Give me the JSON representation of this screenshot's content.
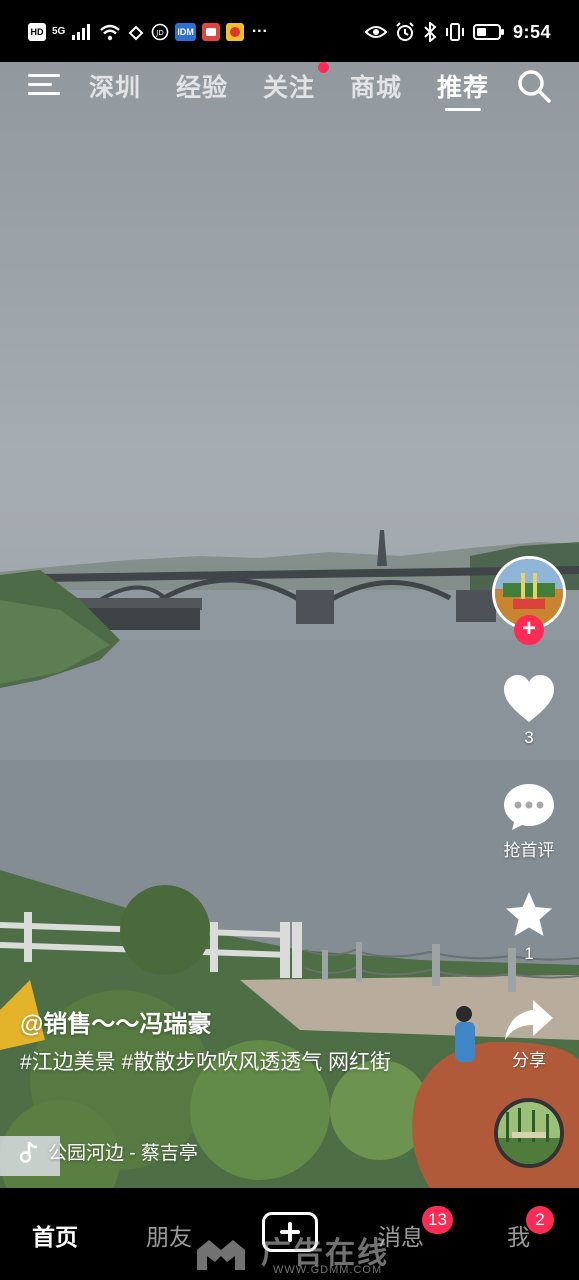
{
  "status_bar": {
    "left_chips": [
      "HD",
      "5G",
      "IDM"
    ],
    "time": "9:54"
  },
  "top_nav": {
    "tabs": [
      {
        "label": "深圳",
        "active": false
      },
      {
        "label": "经验",
        "active": false
      },
      {
        "label": "关注",
        "active": false
      },
      {
        "label": "商城",
        "active": false
      },
      {
        "label": "推荐",
        "active": true
      }
    ]
  },
  "actions": {
    "like_count": "3",
    "comment_label": "抢首评",
    "favorite_count": "1",
    "share_label": "分享"
  },
  "caption": {
    "author": "@销售～～冯瑞豪",
    "description": "#江边美景 #散散步吹吹风透透气 网红街",
    "music": "公园河边 - 蔡吉亭"
  },
  "bottom_nav": {
    "home": "首页",
    "friends": "朋友",
    "messages": "消息",
    "messages_badge": "13",
    "me": "我",
    "me_badge": "2"
  },
  "watermark": {
    "text": "广告在线",
    "url": "WWW.GDMM.COM"
  },
  "colors": {
    "accent": "#fe2c55",
    "background": "#000000"
  }
}
